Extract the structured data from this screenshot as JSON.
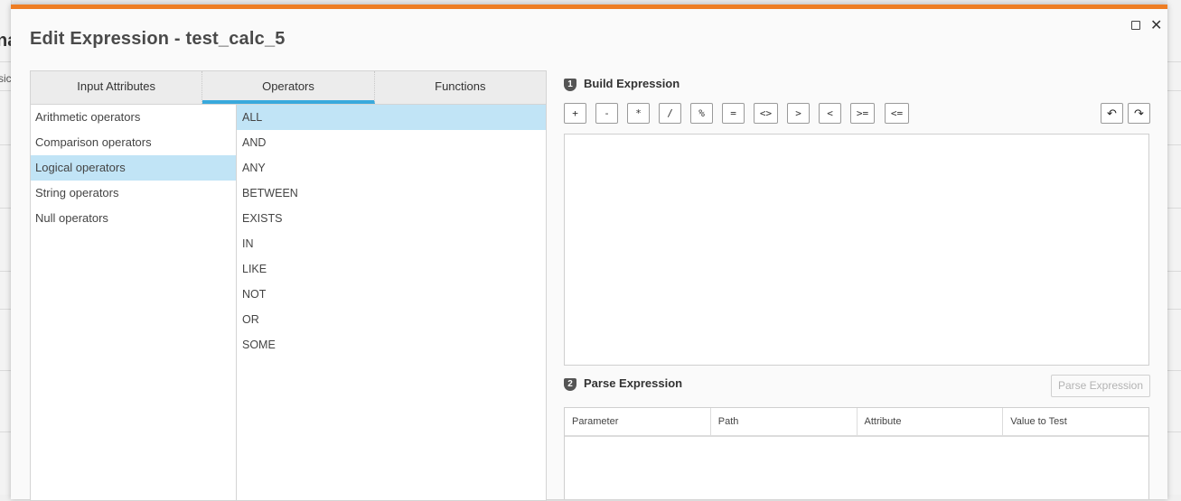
{
  "background": {
    "partial_heading": "na",
    "partial_label": "sic"
  },
  "dialog": {
    "title": "Edit Expression - test_calc_5",
    "accent_color": "#ee7d23",
    "maximize_icon": "square-icon",
    "close_label": "✕"
  },
  "tabs": [
    {
      "label": "Input Attributes",
      "active": false
    },
    {
      "label": "Operators",
      "active": true
    },
    {
      "label": "Functions",
      "active": false
    }
  ],
  "categories": [
    {
      "label": "Arithmetic operators",
      "selected": false
    },
    {
      "label": "Comparison operators",
      "selected": false
    },
    {
      "label": "Logical operators",
      "selected": true
    },
    {
      "label": "String operators",
      "selected": false
    },
    {
      "label": "Null operators",
      "selected": false
    }
  ],
  "operators": [
    {
      "label": "ALL",
      "selected": true
    },
    {
      "label": "AND",
      "selected": false
    },
    {
      "label": "ANY",
      "selected": false
    },
    {
      "label": "BETWEEN",
      "selected": false
    },
    {
      "label": "EXISTS",
      "selected": false
    },
    {
      "label": "IN",
      "selected": false
    },
    {
      "label": "LIKE",
      "selected": false
    },
    {
      "label": "NOT",
      "selected": false
    },
    {
      "label": "OR",
      "selected": false
    },
    {
      "label": "SOME",
      "selected": false
    }
  ],
  "build": {
    "step": "1",
    "title": "Build Expression",
    "buttons": [
      "+",
      "-",
      "*",
      "/",
      "%",
      "=",
      "<>",
      ">",
      "<",
      ">=",
      "<="
    ],
    "undo_icon": "undo-icon",
    "redo_icon": "redo-icon",
    "expression": ""
  },
  "parse": {
    "step": "2",
    "title": "Parse Expression",
    "button_label": "Parse Expression",
    "columns": [
      "Parameter",
      "Path",
      "Attribute",
      "Value to Test"
    ]
  },
  "selection_color": "#c1e4f6",
  "tab_indicator_color": "#39a9dc"
}
